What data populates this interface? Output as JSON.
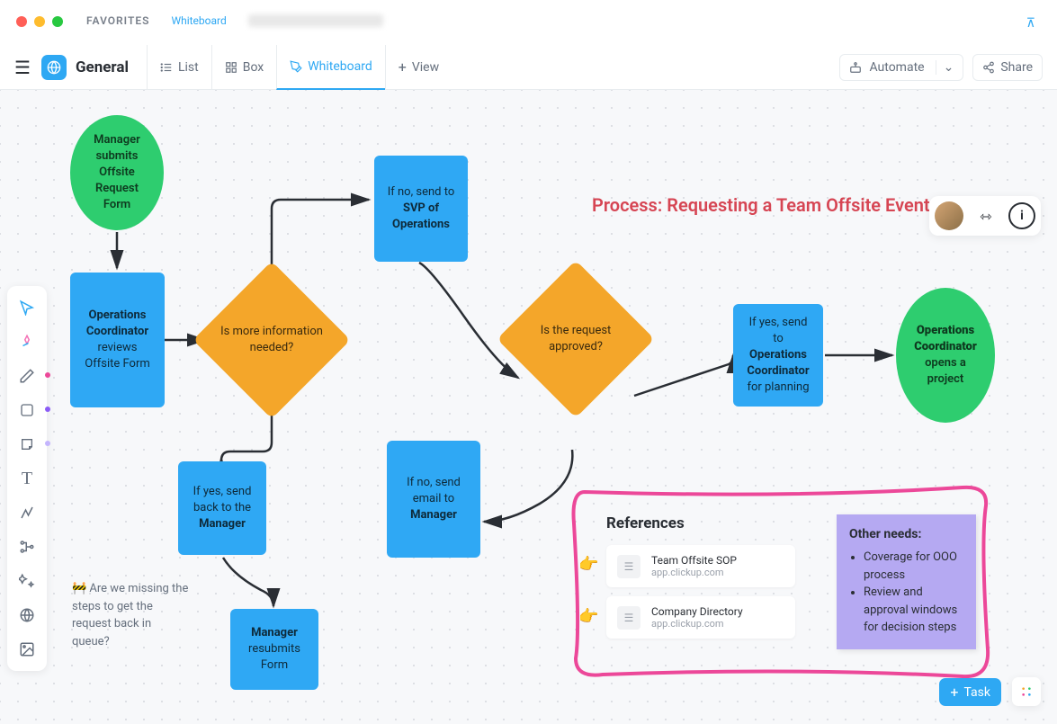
{
  "topbar": {
    "favorites": "FAVORITES",
    "whiteboard": "Whiteboard"
  },
  "header": {
    "title": "General",
    "views": {
      "list": "List",
      "box": "Box",
      "whiteboard": "Whiteboard",
      "add": "View"
    },
    "automate": "Automate",
    "share": "Share"
  },
  "process_title": "Process: Requesting a Team Offsite Event",
  "nodes": {
    "start": {
      "l1": "Manager submits Offsite Request Form"
    },
    "review": {
      "l1": "Operations Coordinator",
      "l2": "reviews Offsite Form"
    },
    "info_needed": "Is more information needed?",
    "svp": {
      "l1": "If no, send to",
      "l2": "SVP of Operations"
    },
    "resend": {
      "l1": "If yes, send back to the",
      "l2": "Manager"
    },
    "approved": "Is the request approved?",
    "noemail": {
      "l1": "If no, send email to",
      "l2": "Manager"
    },
    "plan": {
      "l1": "If yes, send to",
      "l2": "Operations Coordinator",
      "l3": "for planning"
    },
    "open": {
      "l1": "Operations Coordinator",
      "l2": "opens a project"
    },
    "resubmit": {
      "l1": "Manager",
      "l2": "resubmits Form"
    }
  },
  "comment": "🚧 Are we missing the steps to get the request back in queue?",
  "references": {
    "title": "References",
    "items": [
      {
        "title": "Team Offsite SOP",
        "sub": "app.clickup.com"
      },
      {
        "title": "Company Directory",
        "sub": "app.clickup.com"
      }
    ]
  },
  "sticky": {
    "title": "Other needs:",
    "items": [
      "Coverage for OOO process",
      "Review and approval windows for decision steps"
    ]
  },
  "task_button": "Task"
}
